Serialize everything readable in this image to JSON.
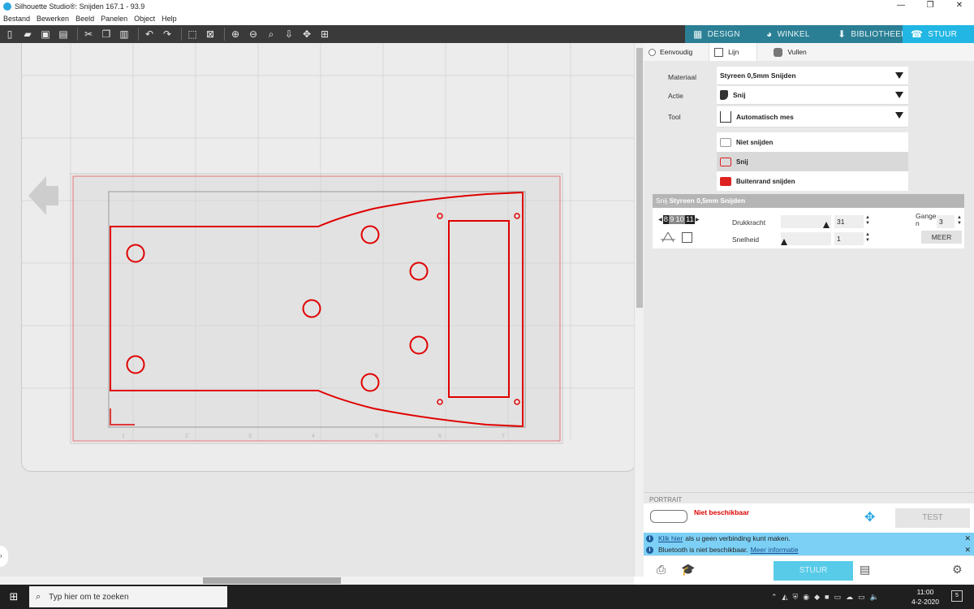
{
  "window": {
    "title": "Silhouette Studio®: Snijden 167.1 - 93.9",
    "controls": [
      "—",
      "❐",
      "✕"
    ]
  },
  "menu": [
    "Bestand",
    "Bewerken",
    "Beeld",
    "Panelen",
    "Object",
    "Help"
  ],
  "tabs": [
    {
      "label": "DESIGN",
      "icon": "grid-icon"
    },
    {
      "label": "WINKEL",
      "icon": "store-icon"
    },
    {
      "label": "BIBLIOTHEEK",
      "icon": "library-icon"
    },
    {
      "label": "STUUR",
      "icon": "send-icon"
    }
  ],
  "cut_panel": {
    "modes": [
      "Eenvoudig",
      "Lijn",
      "Vullen"
    ],
    "material_label": "Materiaal",
    "material_value": "Styreen 0,5mm Snijden",
    "action_label": "Actie",
    "action_value": "Snij",
    "tool_label": "Tool",
    "tool_value": "Automatisch mes",
    "cut_options": [
      "Niet snijden",
      "Snij",
      "Buitenrand snijden"
    ],
    "settings_title_prefix": "Snij",
    "settings_title": "Styreen 0,5mm Snijden",
    "blade_digits": [
      "8",
      "9",
      "10",
      "11"
    ],
    "pressure_label": "Drukkracht",
    "pressure_value": "31",
    "speed_label": "Snelheid",
    "speed_value": "1",
    "passes_label_a": "Gange",
    "passes_label_b": "n",
    "passes_value": "3",
    "more_label": "MEER"
  },
  "device": {
    "header": "PORTRAIT",
    "status": "Niet beschikbaar",
    "test_label": "TEST",
    "send_label": "STUUR"
  },
  "infobar": {
    "line1_link": "Klik hier",
    "line1_text": "als u geen verbinding kunt maken.",
    "line2_text": "Bluetooth is niet beschikbaar.",
    "line2_link": "Meer informatie"
  },
  "taskbar": {
    "search_placeholder": "Typ hier om te zoeken",
    "time": "11:00",
    "date": "4-2-2020",
    "notification_count": "5"
  },
  "ruler_numbers": [
    "1",
    "2",
    "3",
    "4",
    "5",
    "6",
    "7"
  ],
  "colors": {
    "accent": "#21b6e3",
    "cut_line": "#e00000"
  }
}
